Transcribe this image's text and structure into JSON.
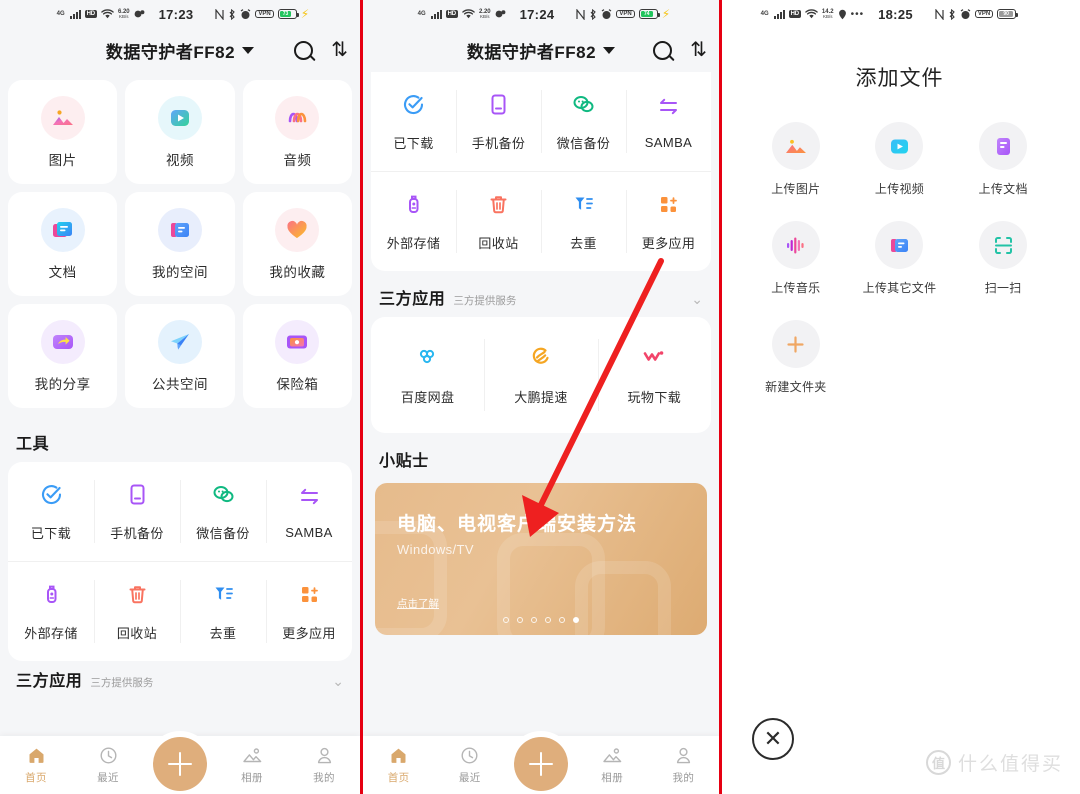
{
  "panels": [
    {
      "status": {
        "time": "17:23",
        "speed": "6.20",
        "speed_unit": "KB/s",
        "network": "4G",
        "hd": "HD",
        "vpn": "VPN",
        "battery": "73"
      },
      "header": {
        "title": "数据守护者FF82",
        "search_icon": "search-icon",
        "sort_icon": "sort-icon",
        "caret_icon": "chevron-down-icon"
      },
      "categories": [
        {
          "label": "图片",
          "icon": "image-icon"
        },
        {
          "label": "视频",
          "icon": "video-icon"
        },
        {
          "label": "音频",
          "icon": "audio-icon"
        },
        {
          "label": "文档",
          "icon": "document-icon"
        },
        {
          "label": "我的空间",
          "icon": "my-space-icon"
        },
        {
          "label": "我的收藏",
          "icon": "favorites-heart-icon"
        },
        {
          "label": "我的分享",
          "icon": "share-icon"
        },
        {
          "label": "公共空间",
          "icon": "public-space-plane-icon"
        },
        {
          "label": "保险箱",
          "icon": "safe-box-icon"
        }
      ],
      "tools_section": {
        "title": "工具"
      },
      "tools": [
        {
          "label": "已下载",
          "icon": "downloaded-check-icon"
        },
        {
          "label": "手机备份",
          "icon": "phone-backup-icon"
        },
        {
          "label": "微信备份",
          "icon": "wechat-backup-icon"
        },
        {
          "label": "SAMBA",
          "icon": "samba-arrows-icon"
        },
        {
          "label": "外部存储",
          "icon": "usb-storage-icon"
        },
        {
          "label": "回收站",
          "icon": "trash-icon"
        },
        {
          "label": "去重",
          "icon": "dedupe-filter-icon"
        },
        {
          "label": "更多应用",
          "icon": "more-apps-icon"
        }
      ],
      "thirdparty_section": {
        "title": "三方应用",
        "subtitle": "三方提供服务",
        "chevron": "chevron-down-icon"
      },
      "tabs": [
        {
          "label": "首页",
          "icon": "home-icon",
          "active": true
        },
        {
          "label": "最近",
          "icon": "recent-clock-icon",
          "active": false
        },
        {
          "label": "相册",
          "icon": "album-icon",
          "active": false
        },
        {
          "label": "我的",
          "icon": "profile-icon",
          "active": false
        }
      ],
      "fab": {
        "icon": "plus-icon"
      }
    },
    {
      "status": {
        "time": "17:24",
        "speed": "2.20",
        "speed_unit": "KB/s",
        "network": "4G",
        "hd": "HD",
        "vpn": "VPN",
        "battery": "74"
      },
      "header": {
        "title": "数据守护者FF82",
        "search_icon": "search-icon",
        "sort_icon": "sort-icon",
        "caret_icon": "chevron-down-icon"
      },
      "tools": [
        {
          "label": "已下载",
          "icon": "downloaded-check-icon"
        },
        {
          "label": "手机备份",
          "icon": "phone-backup-icon"
        },
        {
          "label": "微信备份",
          "icon": "wechat-backup-icon"
        },
        {
          "label": "SAMBA",
          "icon": "samba-arrows-icon"
        },
        {
          "label": "外部存储",
          "icon": "usb-storage-icon"
        },
        {
          "label": "回收站",
          "icon": "trash-icon"
        },
        {
          "label": "去重",
          "icon": "dedupe-filter-icon"
        },
        {
          "label": "更多应用",
          "icon": "more-apps-icon"
        }
      ],
      "thirdparty_section": {
        "title": "三方应用",
        "subtitle": "三方提供服务",
        "chevron": "chevron-down-icon"
      },
      "thirdparty_apps": [
        {
          "label": "百度网盘",
          "icon": "baidu-netdisk-icon"
        },
        {
          "label": "大鹏提速",
          "icon": "dapeng-speedup-icon"
        },
        {
          "label": "玩物下载",
          "icon": "wanwu-download-icon"
        }
      ],
      "tips_section": {
        "title": "小贴士"
      },
      "banner": {
        "title": "电脑、电视客户端安装方法",
        "subtitle": "Windows/TV",
        "link": "点击了解",
        "dots_total": 6,
        "dots_active_index": 5
      },
      "tabs": [
        {
          "label": "首页",
          "icon": "home-icon",
          "active": true
        },
        {
          "label": "最近",
          "icon": "recent-clock-icon",
          "active": false
        },
        {
          "label": "相册",
          "icon": "album-icon",
          "active": false
        },
        {
          "label": "我的",
          "icon": "profile-icon",
          "active": false
        }
      ],
      "fab": {
        "icon": "plus-icon"
      },
      "annotation": {
        "type": "red-arrow",
        "points_to": "fab-add-button"
      }
    },
    {
      "status": {
        "time": "18:25",
        "speed": "14.2",
        "speed_unit": "KB/s",
        "network": "4G",
        "hd": "HD",
        "vpn": "VPN",
        "battery": "90",
        "location_icon": "location-pin-icon",
        "more_icon": "ellipsis-icon"
      },
      "title": "添加文件",
      "actions": [
        {
          "label": "上传图片",
          "icon": "upload-image-icon"
        },
        {
          "label": "上传视频",
          "icon": "upload-video-icon"
        },
        {
          "label": "上传文档",
          "icon": "upload-document-icon"
        },
        {
          "label": "上传音乐",
          "icon": "upload-music-icon"
        },
        {
          "label": "上传其它文件",
          "icon": "upload-other-file-icon"
        },
        {
          "label": "扫一扫",
          "icon": "scan-qr-icon"
        },
        {
          "label": "新建文件夹",
          "icon": "new-folder-plus-icon"
        }
      ],
      "close": {
        "icon": "close-x-icon"
      }
    }
  ],
  "watermark": {
    "logo": "值",
    "text": "什么值得买"
  },
  "colors": {
    "accent": "#dfae7c",
    "annotation_red": "#e60012",
    "divider_red": "#e60012"
  }
}
